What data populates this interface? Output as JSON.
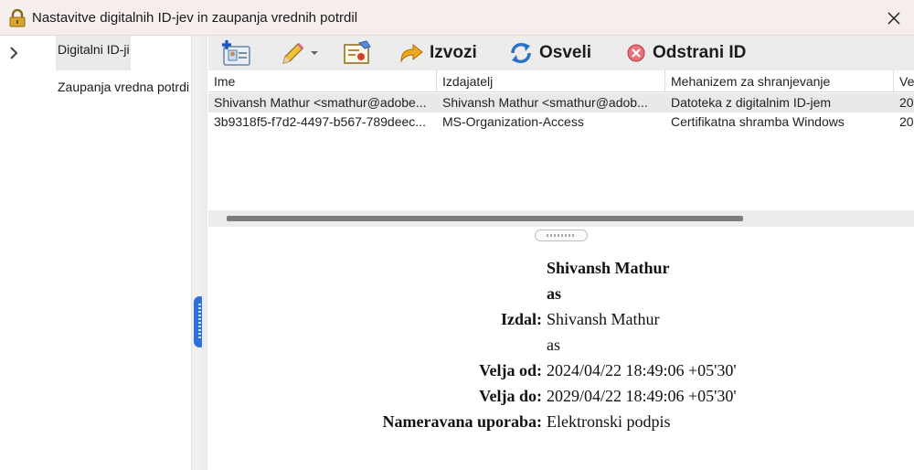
{
  "window": {
    "title": "Nastavitve digitalnih ID-jev in zaupanja vrednih potrdil"
  },
  "nav": {
    "items": [
      {
        "label": "Digitalni ID-ji",
        "selected": true
      },
      {
        "label": "Zaupanja vredna potrdi",
        "selected": false
      }
    ]
  },
  "toolbar": {
    "export_label": "Izvozi",
    "refresh_label": "Osveli",
    "remove_label": "Odstrani ID"
  },
  "table": {
    "headers": [
      "Ime",
      "Izdajatelj",
      "Mehanizem za shranjevanje",
      "Ve"
    ],
    "rows": [
      [
        "Shivansh Mathur <smathur@adobe...",
        "Shivansh Mathur <smathur@adob...",
        "Datoteka z digitalnim ID-jem",
        "20"
      ],
      [
        "3b9318f5-f7d2-4497-b567-789deec...",
        "MS-Organization-Access",
        "Certifikatna shramba Windows",
        "20"
      ]
    ]
  },
  "details": {
    "name_line1": "Shivansh Mathur",
    "name_line2": "as",
    "issued_by_label": "Izdal:",
    "issued_by_line1": "Shivansh Mathur",
    "issued_by_line2": "as",
    "valid_from_label": "Velja od:",
    "valid_from": "2024/04/22 18:49:06 +05'30'",
    "valid_to_label": "Velja do:",
    "valid_to": "2029/04/22 18:49:06 +05'30'",
    "usage_label": "Nameravana uporaba:",
    "usage": "Elektronski podpis"
  }
}
